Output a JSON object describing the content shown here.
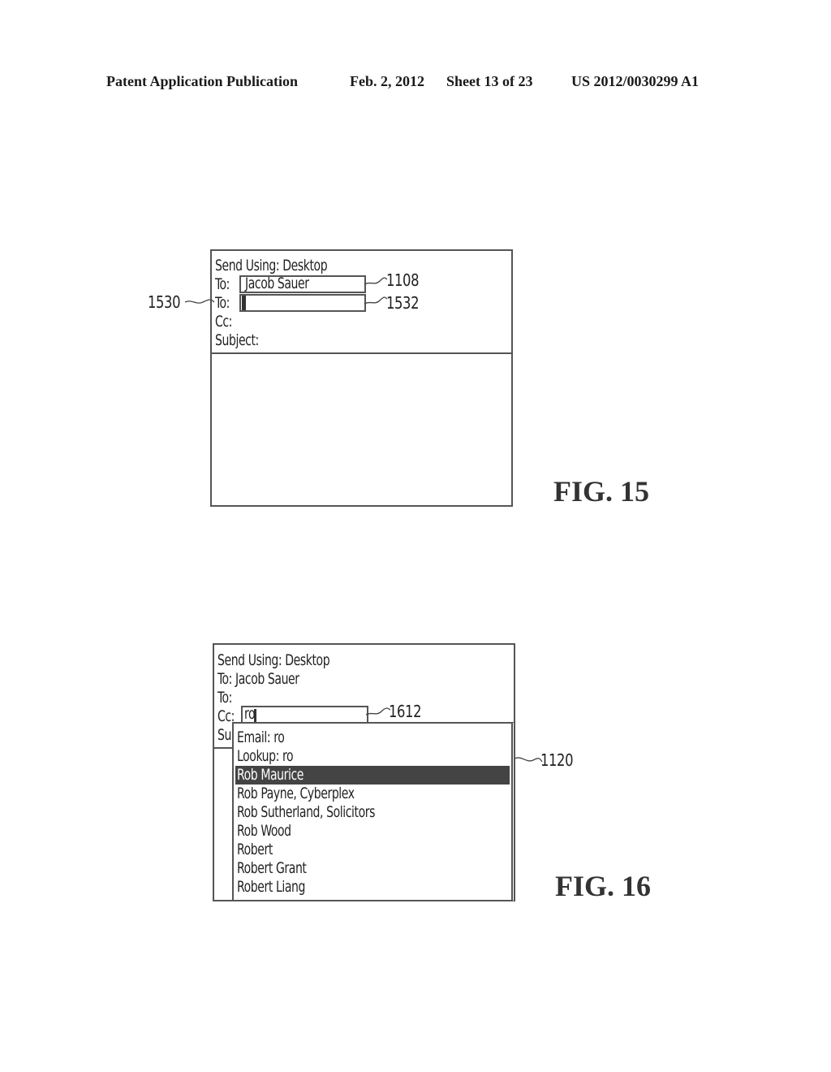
{
  "header": {
    "publication": "Patent Application Publication",
    "date": "Feb. 2, 2012",
    "sheet": "Sheet 13 of 23",
    "number": "US 2012/0030299 A1"
  },
  "fig15": {
    "label": "FIG. 15",
    "send_using": "Send Using: Desktop",
    "to_label_1": "To:",
    "to_value_1": "Jacob Sauer",
    "to_label_2": "To:",
    "to_value_2": "",
    "cc_label": "Cc:",
    "subject_label": "Subject:",
    "refs": {
      "to_field_1": "1108",
      "to_row_2": "1530",
      "to_field_2": "1532"
    }
  },
  "fig16": {
    "label": "FIG. 16",
    "send_using": "Send Using: Desktop",
    "to_line_1": "To: Jacob Sauer",
    "to_line_2": "To:",
    "cc_label": "Cc:",
    "cc_value": "ro",
    "subject_partial": "Su",
    "refs": {
      "cc_field": "1612",
      "dropdown": "1120"
    },
    "dropdown_items": [
      {
        "label": "Email: ro",
        "selected": false
      },
      {
        "label": "Lookup: ro",
        "selected": false
      },
      {
        "label": "Rob Maurice",
        "selected": true
      },
      {
        "label": "Rob Payne, Cyberplex",
        "selected": false
      },
      {
        "label": "Rob Sutherland, Solicitors",
        "selected": false
      },
      {
        "label": "Rob Wood",
        "selected": false
      },
      {
        "label": "Robert",
        "selected": false
      },
      {
        "label": "Robert Grant",
        "selected": false
      },
      {
        "label": "Robert Liang",
        "selected": false
      }
    ]
  }
}
